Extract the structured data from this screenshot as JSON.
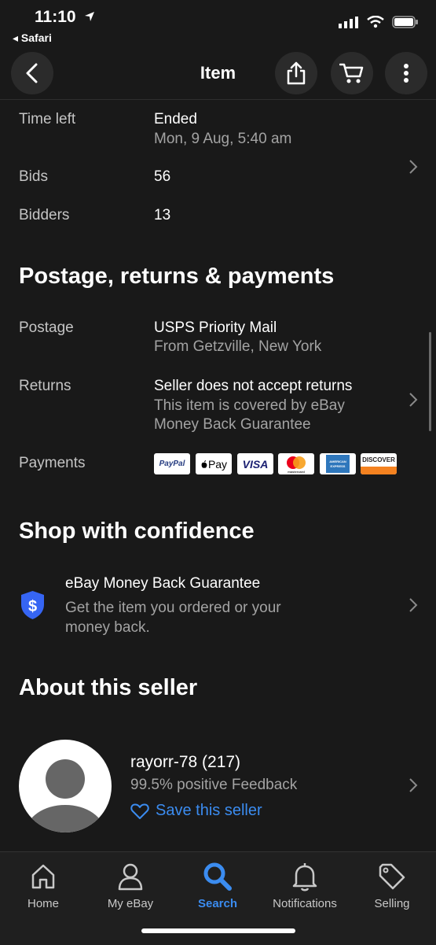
{
  "status_bar": {
    "time": "11:10",
    "back_app": "◂ Safari"
  },
  "nav": {
    "title": "Item"
  },
  "details": {
    "time_left_label": "Time left",
    "time_left_value": "Ended",
    "time_left_date": "Mon, 9 Aug, 5:40 am",
    "bids_label": "Bids",
    "bids_value": "56",
    "bidders_label": "Bidders",
    "bidders_value": "13"
  },
  "postage_section": {
    "heading": "Postage, returns & payments",
    "postage_label": "Postage",
    "postage_value": "USPS Priority Mail",
    "postage_from": "From Getzville, New York",
    "returns_label": "Returns",
    "returns_value": "Seller does not accept returns",
    "returns_line2": "This item is covered by eBay",
    "returns_line3": "Money Back Guarantee",
    "payments_label": "Payments",
    "payment_methods": [
      "PayPal",
      "Pay",
      "VISA",
      "mastercard",
      "AMERICAN EXPRESS",
      "DISCOVER"
    ]
  },
  "confidence_section": {
    "heading": "Shop with confidence",
    "guarantee_title": "eBay Money Back Guarantee",
    "guarantee_line1": "Get the item you ordered or your",
    "guarantee_line2": "money back."
  },
  "seller_section": {
    "heading": "About this seller",
    "seller_name": "rayorr-78 (217)",
    "feedback": "99.5% positive Feedback",
    "save_label": "Save this seller"
  },
  "tab_bar": {
    "home": "Home",
    "my_ebay": "My eBay",
    "search": "Search",
    "notifications": "Notifications",
    "selling": "Selling"
  },
  "colors": {
    "background": "#191919",
    "accent": "#3b8cf0",
    "shield": "#3665f3"
  }
}
